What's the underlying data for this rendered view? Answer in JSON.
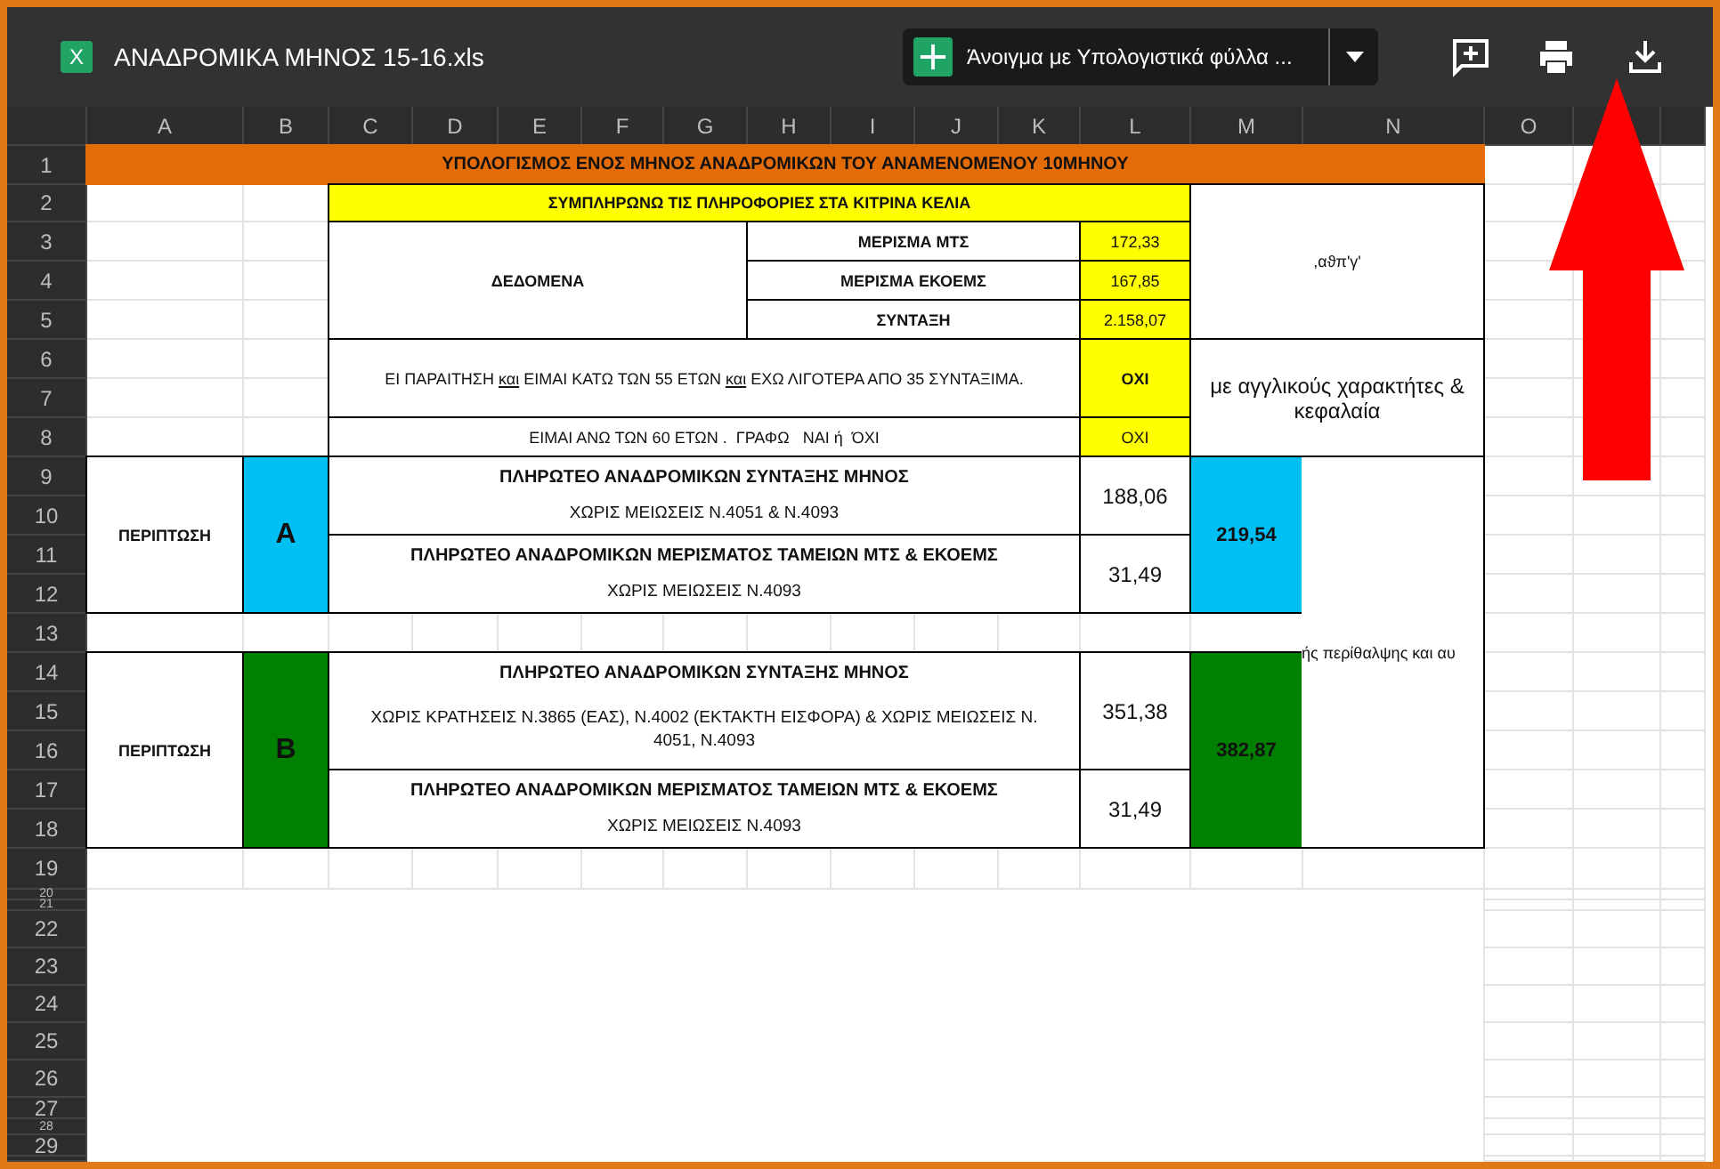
{
  "app_bar": {
    "app_letter": "X",
    "file_name": "ΑΝΑΔΡΟΜΙΚΑ ΜΗΝΟΣ 15-16.xls",
    "open_with": "Άνοιγμα με Υπολογιστικά φύλλα ..."
  },
  "column_headers": [
    "A",
    "B",
    "C",
    "D",
    "E",
    "F",
    "G",
    "H",
    "I",
    "J",
    "K",
    "L",
    "M",
    "N",
    "O"
  ],
  "row_headers": [
    "1",
    "2",
    "3",
    "4",
    "5",
    "6",
    "7",
    "8",
    "9",
    "10",
    "11",
    "12",
    "13",
    "14",
    "15",
    "16",
    "17",
    "18",
    "19",
    "20",
    "21",
    "22",
    "23",
    "24",
    "25",
    "26",
    "27",
    "28",
    "29"
  ],
  "sheet": {
    "title": "ΥΠΟΛΟΓΙΣΜΟΣ  ΕΝΟΣ  ΜΗΝΟΣ  ΑΝΑΔΡΟΜΙΚΩΝ   ΤΟΥ  ΑΝΑΜΕΝΟΜΕΝΟΥ  10ΜΗΝΟΥ",
    "instruction": "ΣΥΜΠΛΗΡΩΝΩ  ΤΙΣ  ΠΛΗΡΟΦΟΡΙΕΣ  ΣΤΑ  ΚΙΤΡΙΝΑ  ΚΕΛΙΑ",
    "data_label": "ΔΕΔΟΜΕΝΑ",
    "inputs": [
      {
        "label": "ΜΕΡΙΣΜΑ ΜΤΣ",
        "value": "172,33"
      },
      {
        "label": "ΜΕΡΙΣΜΑ ΕΚΟΕΜΣ",
        "value": "167,85"
      },
      {
        "label": "ΣΥΝΤΑΞΗ",
        "value": "2.158,07"
      }
    ],
    "garbled_note": ",αϑπ'γ'",
    "questions": [
      {
        "parts": [
          {
            "text": "ΕΙ ΠΑΡΑΙΤΗΣΗ ",
            "underline": false
          },
          {
            "text": "και",
            "underline": true
          },
          {
            "text": " ΕΙΜΑΙ ΚΑΤΩ ΤΩΝ 55 ΕΤΩΝ ",
            "underline": false
          },
          {
            "text": "και",
            "underline": true
          },
          {
            "text": " ΕΧΩ ΛΙΓΟΤΕΡΑ ΑΠΟ 35 ΣΥΝΤΑΞΙΜΑ.",
            "underline": false
          }
        ],
        "answer": "ΟΧΙ",
        "bold": true
      },
      {
        "parts": [
          {
            "text": "ΕΙΜΑΙ ΑΝΩ ΤΩΝ 60 ΕΤΩΝ .  ΓΡΑΦΩ   ΝΑΙ ή  ΌΧΙ",
            "underline": false
          }
        ],
        "answer": "ΟΧΙ",
        "bold": false
      }
    ],
    "note": "με αγγλικούς χαρακτήτες & κεφαλαία",
    "cases": [
      {
        "label": "ΠΕΡΙΠΤΩΣΗ",
        "letter": "A",
        "color": "#00bff3",
        "items": [
          {
            "heading": "ΠΛΗΡΩΤΕΟ ΑΝΑΔΡΟΜΙΚΩΝ ΣΥΝΤΑΞΗΣ ΜΗΝΟΣ",
            "detail": "ΧΩΡΙΣ ΜΕΙΩΣΕΙΣ Ν.4051 & Ν.4093",
            "amount": "188,06"
          },
          {
            "heading": "ΠΛΗΡΩΤΕΟ ΑΝΑΔΡΟΜΙΚΩΝ  ΜΕΡΙΣΜΑΤΟΣ  ΤΑΜΕΙΩΝ  ΜΤΣ  &  ΕΚΟΕΜΣ",
            "detail": "ΧΩΡΙΣ ΜΕΙΩΣΕΙΣ Ν.4093",
            "amount": "31,49"
          }
        ],
        "total": "219,54"
      },
      {
        "label": "ΠΕΡΙΠΤΩΣΗ",
        "letter": "B",
        "color": "#008000",
        "items": [
          {
            "heading": "ΠΛΗΡΩΤΕΟ ΑΝΑΔΡΟΜΙΚΩΝ ΣΥΝΤΑΞΗΣ ΜΗΝΟΣ",
            "detail": "ΧΩΡΙΣ ΚΡΑΤΗΣΕΙΣ Ν.3865 (ΕΑΣ), Ν.4002 (ΕΚΤΑΚΤΗ ΕΙΣΦΟΡΑ) & ΧΩΡΙΣ ΜΕΙΩΣΕΙΣ Ν. 4051,  Ν.4093",
            "amount": "351,38"
          },
          {
            "heading": "ΠΛΗΡΩΤΕΟ ΑΝΑΔΡΟΜΙΚΩΝ  ΜΕΡΙΣΜΑΤΟΣ  ΤΑΜΕΙΩΝ  ΜΤΣ  &  ΕΚΟΕΜΣ",
            "detail": "ΧΩΡΙΣ ΜΕΙΩΣΕΙΣ Ν.4093",
            "amount": "31,49"
          }
        ],
        "total": "382,87"
      }
    ],
    "side_note": "ής περίθαλψης και αυ"
  }
}
